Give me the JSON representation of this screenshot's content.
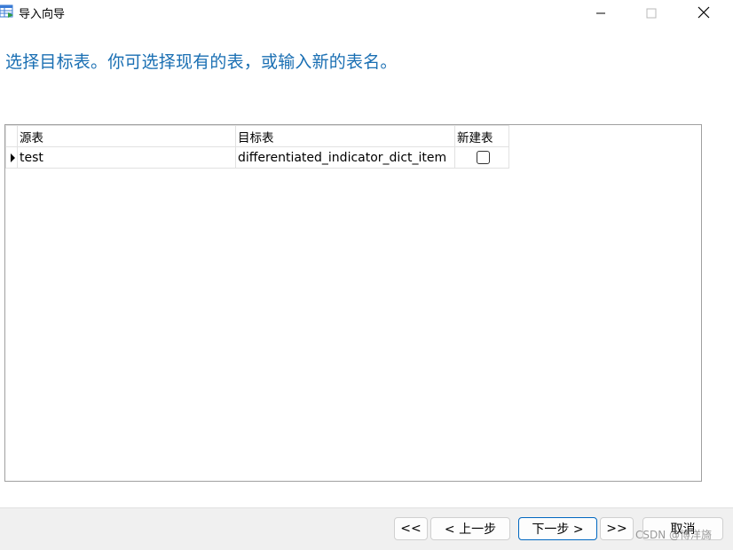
{
  "window": {
    "title": "导入向导"
  },
  "heading": "选择目标表。你可选择现有的表，或输入新的表名。",
  "grid": {
    "columns": [
      "源表",
      "目标表",
      "新建表"
    ],
    "rows": [
      {
        "source": "test",
        "target": "differentiated_indicator_dict_item",
        "new_table": false
      }
    ]
  },
  "buttons": {
    "first": "<<",
    "prev": "< 上一步",
    "next": "下一步 >",
    "last": ">>",
    "cancel": "取消"
  },
  "watermark": "CSDN @博洋旖",
  "colors": {
    "heading": "#1a6fb3",
    "footer": "#f0f0f0",
    "accent": "#0067c0"
  },
  "icons": [
    "import-wizard-icon",
    "minimize-icon",
    "maximize-icon",
    "close-icon",
    "row-indicator-icon",
    "checkbox"
  ]
}
